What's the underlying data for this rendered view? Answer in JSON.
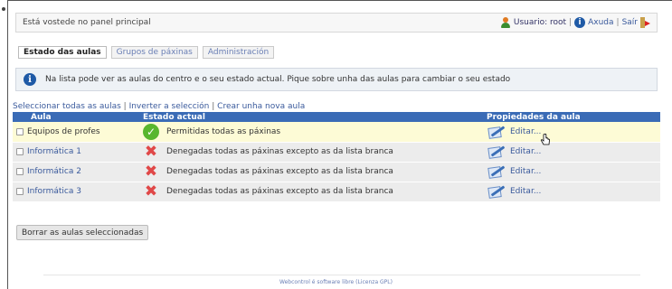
{
  "header": {
    "welcome": "Está vostede no panel principal",
    "user_label": "Usuario: root",
    "help_label": "Axuda",
    "exit_label": "Saír",
    "separator": "|"
  },
  "tabs": [
    {
      "label": "Estado das aulas",
      "active": true
    },
    {
      "label": "Grupos de páxinas",
      "active": false
    },
    {
      "label": "Administración",
      "active": false
    }
  ],
  "info_message": "Na lista pode ver as aulas do centro e o seu estado actual. Pique sobre unha das aulas para cambiar o seu estado",
  "actions": {
    "select_all": "Seleccionar todas as aulas",
    "invert": "Inverter a selección",
    "create": "Crear unha nova aula",
    "separator": "|"
  },
  "table": {
    "headers": [
      "Aula",
      "Estado actual",
      "Propiedades da aula"
    ],
    "rows": [
      {
        "aula": "Equipos de profes",
        "estado": "Permitidas todas as páxinas",
        "status_icon": "check-icon",
        "edit_label": "Editar..."
      },
      {
        "aula": "Informática 1",
        "estado": "Denegadas todas as páxinas excepto as da lista branca",
        "status_icon": "deny-icon",
        "edit_label": "Editar..."
      },
      {
        "aula": "Informática 2",
        "estado": "Denegadas todas as páxinas excepto as da lista branca",
        "status_icon": "deny-icon",
        "edit_label": "Editar..."
      },
      {
        "aula": "Informática 3",
        "estado": "Denegadas todas as páxinas excepto as da lista branca",
        "status_icon": "deny-icon",
        "edit_label": "Editar..."
      }
    ]
  },
  "delete_button": "Borrar as aulas seleccionadas",
  "footer": "Webcontrol é software libre (Licenza GPL)",
  "colors": {
    "table_header": "#3a6bb6",
    "highlight_row": "#fdfbd6",
    "link": "#3a5a9c"
  }
}
